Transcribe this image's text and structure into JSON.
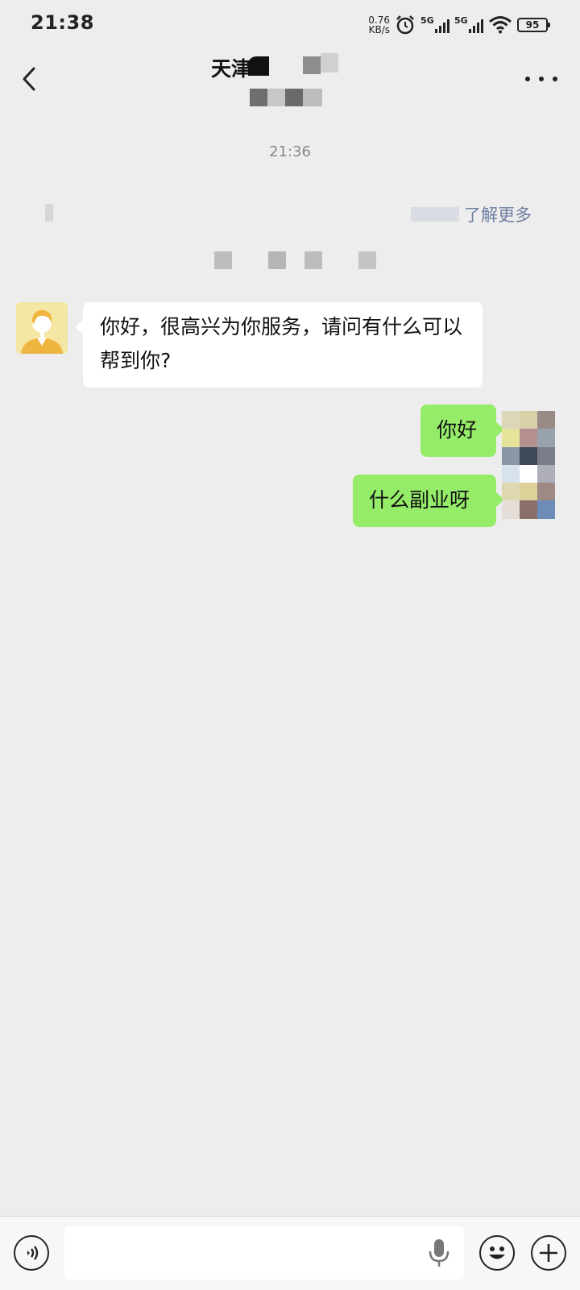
{
  "status_bar": {
    "time": "21:38",
    "net_speed_value": "0.76",
    "net_speed_unit": "KB/s",
    "signal1_label": "5G",
    "signal2_label": "5G",
    "battery": "95",
    "icons": [
      "alarm-icon",
      "signal-icon",
      "signal-icon",
      "wifi-icon",
      "battery-icon"
    ]
  },
  "header": {
    "title": "天津",
    "icons": [
      "back-icon",
      "more-icon"
    ]
  },
  "chat": {
    "timestamp": "21:36",
    "system_link": "了解更多",
    "messages": [
      {
        "side": "in",
        "text": "你好，很高兴为你服务，请问有什么可以帮到你?"
      },
      {
        "side": "out",
        "text": "你好"
      },
      {
        "side": "out",
        "text": "什么副业呀"
      }
    ]
  },
  "input_bar": {
    "placeholder": "",
    "icons": [
      "voice-icon",
      "mic-icon",
      "emoji-icon",
      "plus-icon"
    ]
  },
  "colors": {
    "background": "#ededed",
    "incoming_bubble": "#ffffff",
    "outgoing_bubble": "#95ec69",
    "link": "#576b95",
    "timestamp": "#888888"
  }
}
